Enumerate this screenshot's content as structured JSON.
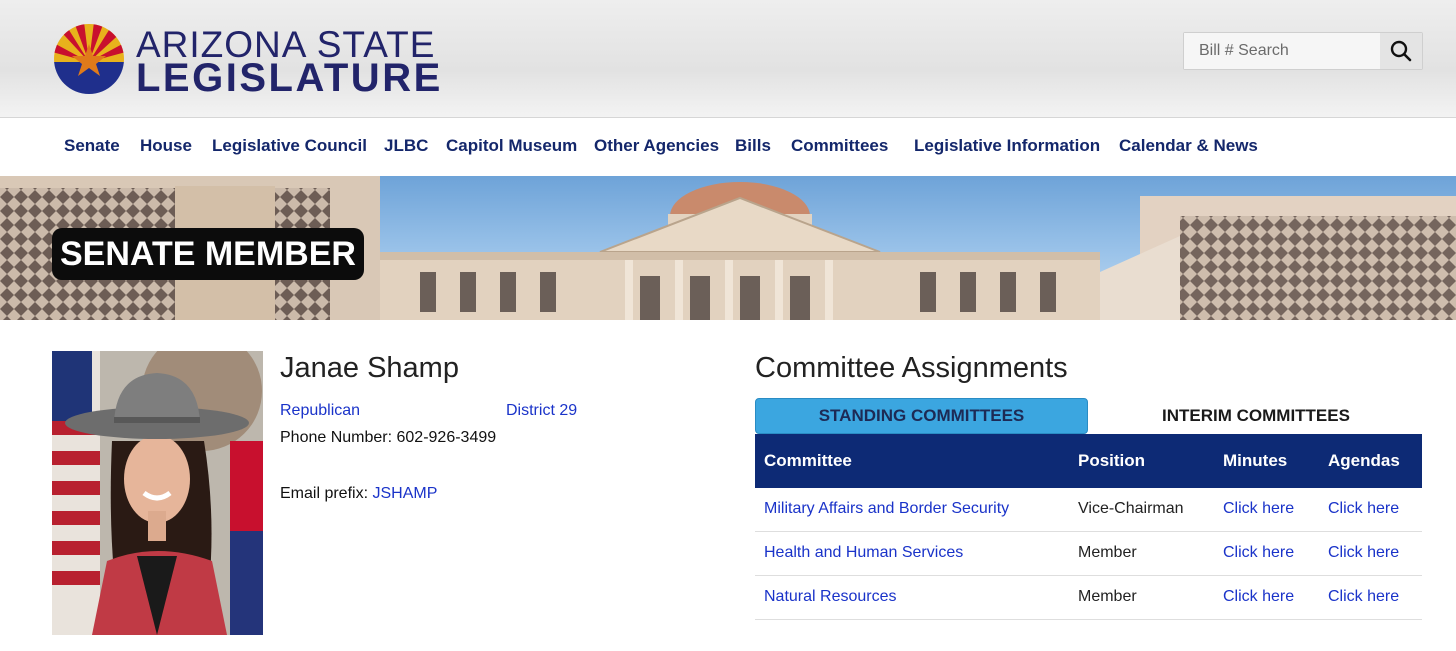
{
  "brand": {
    "line1": "ARIZONA STATE",
    "line2": "LEGISLATURE"
  },
  "search": {
    "placeholder": "Bill # Search"
  },
  "nav": [
    "Senate",
    "House",
    "Legislative Council",
    "JLBC",
    "Capitol Museum",
    "Other Agencies",
    "Bills",
    "Committees",
    "Legislative Information",
    "Calendar & News"
  ],
  "banner": {
    "title": "SENATE MEMBER"
  },
  "member": {
    "name": "Janae Shamp",
    "party": "Republican",
    "district": "District 29",
    "phone_label": "Phone Number: 602-926-3499",
    "email_label": "Email prefix:",
    "email_prefix": "JSHAMP"
  },
  "committees": {
    "title": "Committee Assignments",
    "tabs": [
      "STANDING COMMITTEES",
      "INTERIM COMMITTEES"
    ],
    "headers": [
      "Committee",
      "Position",
      "Minutes",
      "Agendas"
    ],
    "rows": [
      {
        "name": "Military Affairs and Border Security",
        "position": "Vice-Chairman",
        "minutes": "Click here",
        "agendas": "Click here"
      },
      {
        "name": "Health and Human Services",
        "position": "Member",
        "minutes": "Click here",
        "agendas": "Click here"
      },
      {
        "name": "Natural Resources",
        "position": "Member",
        "minutes": "Click here",
        "agendas": "Click here"
      }
    ]
  },
  "colors": {
    "navy": "#14276b",
    "table_header": "#0d2a75",
    "tab_active": "#3ba6e0",
    "link": "#1a33c9"
  }
}
